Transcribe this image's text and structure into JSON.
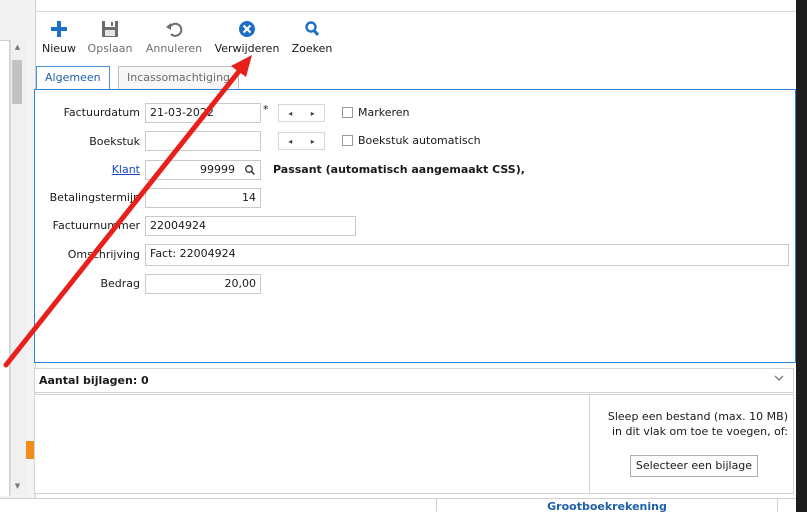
{
  "toolbar": {
    "new_label": "Nieuw",
    "save_label": "Opslaan",
    "cancel_label": "Annuleren",
    "delete_label": "Verwijderen",
    "search_label": "Zoeken"
  },
  "tabs": [
    {
      "label": "Algemeen",
      "active": true
    },
    {
      "label": "Incassomachtiging",
      "active": false
    }
  ],
  "form": {
    "factuurdatum_label": "Factuurdatum",
    "factuurdatum_value": "21-03-2022",
    "required_marker": "*",
    "markeren_label": "Markeren",
    "boekstuk_label": "Boekstuk",
    "boekstuk_value": "",
    "boekstuk_auto_label": "Boekstuk automatisch",
    "klant_label": "Klant",
    "klant_value": "99999",
    "klant_name": "Passant (automatisch aangemaakt CSS),",
    "betalingstermijn_label": "Betalingstermijn",
    "betalingstermijn_value": "14",
    "factuurnummer_label": "Factuurnummer",
    "factuurnummer_value": "22004924",
    "omschrijving_label": "Omschrijving",
    "omschrijving_value": "Fact: 22004924",
    "bedrag_label": "Bedrag",
    "bedrag_value": "20,00",
    "stepper_prev": "◂",
    "stepper_next": "▸"
  },
  "attachments": {
    "header": "Aantal bijlagen: 0",
    "drop_text_line1": "Sleep een bestand (max. 10 MB)",
    "drop_text_line2": "in dit vlak om toe te voegen, of:",
    "select_button": "Selecteer een bijlage"
  },
  "bottom": {
    "grootboek_label": "Grootboekrekening"
  },
  "colors": {
    "accent": "#1e5fa8",
    "annotation_arrow": "#e8201c",
    "orange_marker": "#f28c1c"
  }
}
